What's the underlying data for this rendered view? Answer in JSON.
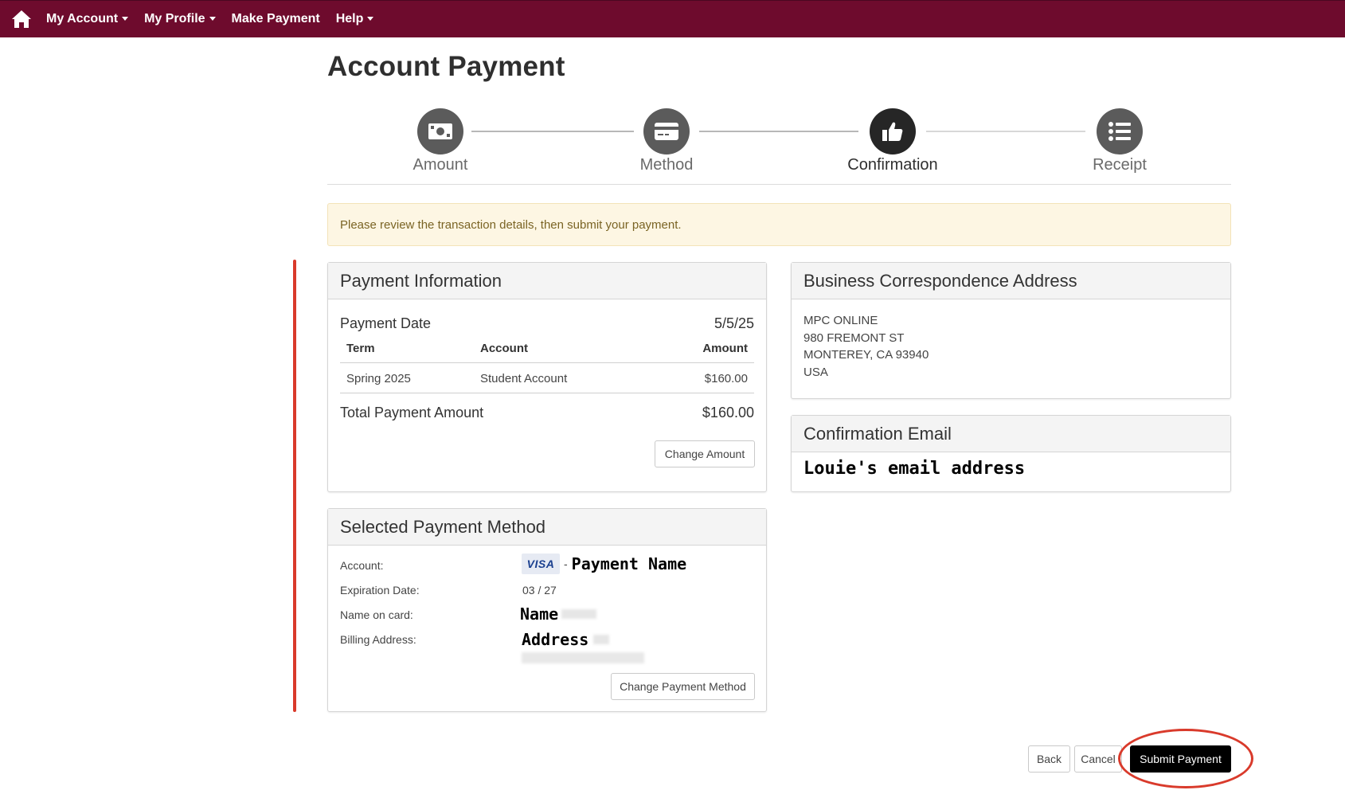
{
  "nav": {
    "home_icon": "home-icon",
    "items": [
      {
        "label": "My Account",
        "dropdown": true
      },
      {
        "label": "My Profile",
        "dropdown": true
      },
      {
        "label": "Make Payment",
        "dropdown": false
      },
      {
        "label": "Help",
        "dropdown": true
      }
    ]
  },
  "page": {
    "title": "Account Payment"
  },
  "steps": [
    {
      "label": "Amount",
      "icon": "money-bill-icon",
      "active": false
    },
    {
      "label": "Method",
      "icon": "credit-card-icon",
      "active": false
    },
    {
      "label": "Confirmation",
      "icon": "thumbs-up-icon",
      "active": true
    },
    {
      "label": "Receipt",
      "icon": "list-icon",
      "active": false
    }
  ],
  "alert": {
    "text": "Please review the transaction details, then submit your payment."
  },
  "payment_info": {
    "heading": "Payment Information",
    "date_label": "Payment Date",
    "date_value": "5/5/25",
    "columns": [
      "Term",
      "Account",
      "Amount"
    ],
    "rows": [
      {
        "term": "Spring 2025",
        "account": "Student Account",
        "amount": "$160.00"
      }
    ],
    "total_label": "Total Payment Amount",
    "total_value": "$160.00",
    "change_amount_label": "Change Amount"
  },
  "payment_method": {
    "heading": "Selected Payment Method",
    "account_label": "Account:",
    "card_brand": "VISA",
    "account_separator": "-",
    "account_name_overlay": "Payment Name",
    "expiration_label": "Expiration Date:",
    "expiration_value": "03 / 27",
    "name_label": "Name on card:",
    "name_overlay": "Name",
    "billing_label": "Billing Address:",
    "address_overlay": "Address",
    "change_method_label": "Change Payment Method"
  },
  "business_address": {
    "heading": "Business Correspondence Address",
    "lines": [
      "MPC ONLINE",
      "980 FREMONT ST",
      "MONTEREY, CA 93940",
      "USA"
    ]
  },
  "confirmation_email": {
    "heading": "Confirmation Email",
    "overlay": "Louie's email address"
  },
  "actions": {
    "back_label": "Back",
    "cancel_label": "Cancel",
    "submit_label": "Submit Payment"
  },
  "colors": {
    "navbar": "#6e0b2d",
    "annotation": "#d93a2b",
    "alert_bg": "#fdf6e3",
    "primary_button": "#000000"
  }
}
